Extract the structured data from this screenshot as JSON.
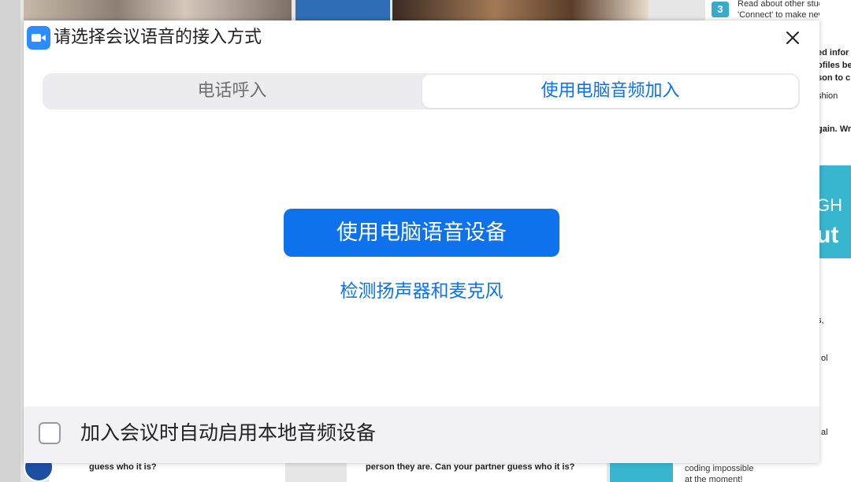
{
  "background": {
    "top_badge": "3",
    "top_lines": [
      "Read about other students",
      "'Connect' to make new frie"
    ],
    "right_lines": [
      "ed infor",
      "ofiles be",
      "son to c",
      "shion",
      "gain. Wr"
    ],
    "right_words": [
      "GH",
      "ut"
    ],
    "right_lower_lines": [
      "s,",
      "ol",
      "al"
    ],
    "bottom_left_text": "guess who it is?",
    "bottom_mid_text": "person they are. Can your partner guess who it is?",
    "bottom_note_lines": [
      "coding impossible",
      "at the moment!"
    ]
  },
  "dialog": {
    "title": "请选择会议语音的接入方式",
    "tabs": [
      {
        "label": "电话呼入",
        "selected": false
      },
      {
        "label": "使用电脑音频加入",
        "selected": true
      }
    ],
    "primary_button": "使用电脑语音设备",
    "test_link": "检测扬声器和麦克风",
    "auto_join_checkbox": {
      "label": "加入会议时自动启用本地音频设备",
      "checked": false
    }
  },
  "colors": {
    "accent": "#0E72ED",
    "app_icon": "#2D8CFF",
    "tab_track": "#ECECF0",
    "footer": "#F2F2F5"
  },
  "icons": {
    "app": "zoom-camera-icon",
    "close": "close-icon"
  }
}
